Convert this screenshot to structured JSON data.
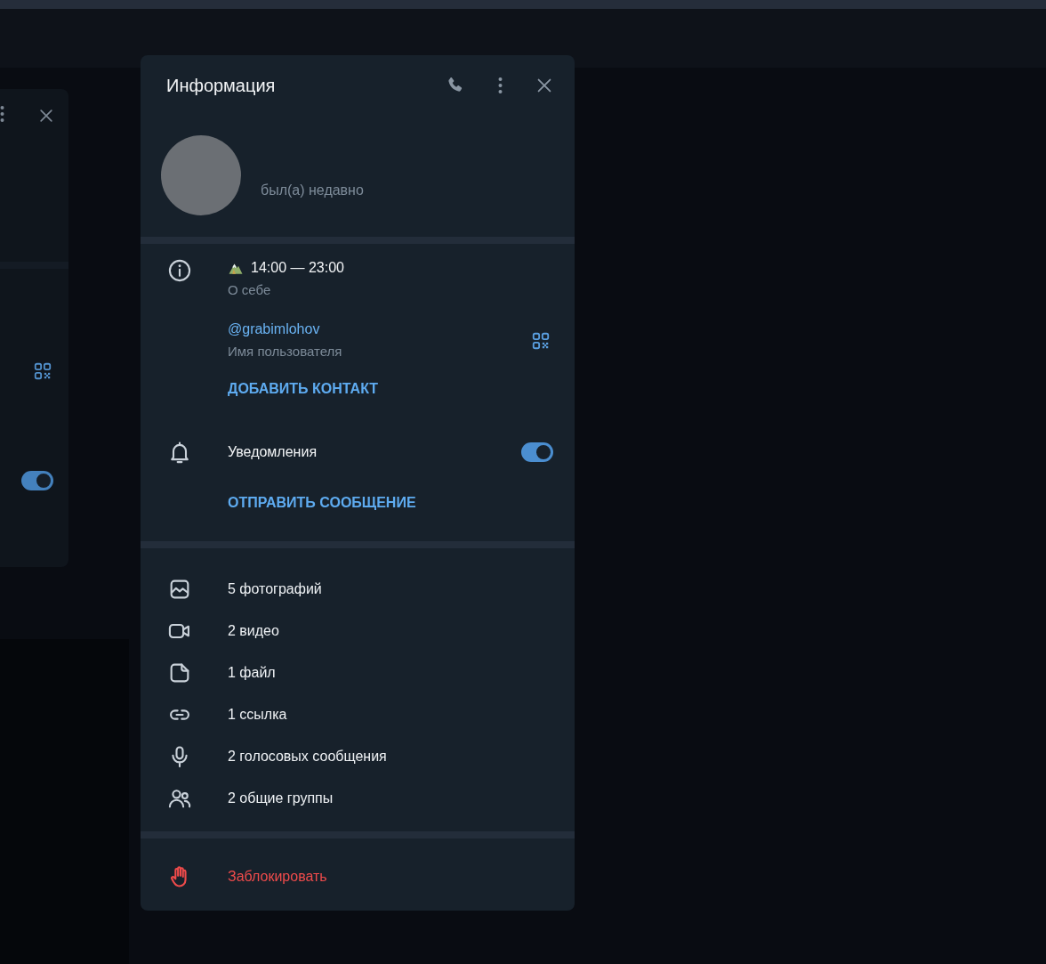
{
  "background_panel": {
    "notifications": {
      "on": true
    }
  },
  "info_panel": {
    "title": "Информация",
    "profile": {
      "status": "был(а) недавно"
    },
    "about": {
      "text": "14:00 — 23:00",
      "label": "О себе"
    },
    "username": {
      "value": "@grabimlohov",
      "label": "Имя пользователя"
    },
    "add_contact": "ДОБАВИТЬ КОНТАКТ",
    "notifications": {
      "label": "Уведомления",
      "on": true
    },
    "send_message": "ОТПРАВИТЬ СООБЩЕНИЕ",
    "media": [
      {
        "kind": "photos",
        "label": "5 фотографий"
      },
      {
        "kind": "videos",
        "label": "2 видео"
      },
      {
        "kind": "files",
        "label": "1 файл"
      },
      {
        "kind": "links",
        "label": "1 ссылка"
      },
      {
        "kind": "voice",
        "label": "2 голосовых сообщения"
      },
      {
        "kind": "groups",
        "label": "2 общие группы"
      }
    ],
    "block": "Заблокировать"
  }
}
